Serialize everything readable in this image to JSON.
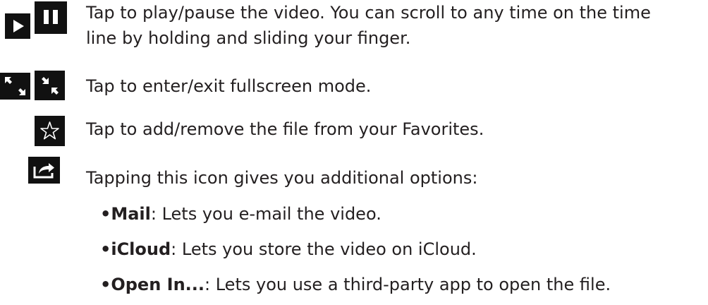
{
  "rows": {
    "play_pause": {
      "line1": "Tap to play/pause the video. You can scroll to any time on the time",
      "line2": "line by holding and sliding your finger.",
      "icons": [
        "play-icon",
        "pause-icon"
      ]
    },
    "fullscreen": {
      "text": "Tap to enter/exit fullscreen mode.",
      "icons": [
        "enter-fullscreen-icon",
        "exit-fullscreen-icon"
      ]
    },
    "favorites": {
      "text": "Tap to add/remove the file from your Favorites.",
      "icons": [
        "star-icon"
      ]
    },
    "share": {
      "text": "Tapping this icon gives you additional options:",
      "icons": [
        "share-icon"
      ]
    }
  },
  "options": [
    {
      "name": "Mail",
      "desc": ": Lets you e-mail the video."
    },
    {
      "name": "iCloud",
      "desc": ": Lets you store the video on iCloud."
    },
    {
      "name": "Open In...",
      "desc": ": Lets you use a third-party app to open the file."
    }
  ],
  "colors": {
    "text": "#231f20",
    "icon_bg": "#111111",
    "icon_fg": "#ffffff"
  }
}
